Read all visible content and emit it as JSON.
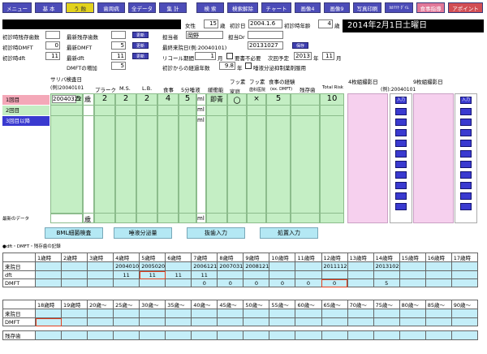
{
  "nav": {
    "menu": "メニュー",
    "basic": "基 本",
    "cavity": "う 蝕",
    "perio": "歯周病",
    "all_data": "全データ",
    "total": "集 計",
    "search": "検 索",
    "search_clear": "検索解除",
    "chart": "チャート",
    "image4": "画像4",
    "image9": "画像9",
    "photo_print": "写真印刷",
    "kakarituke": "ｶｶﾘﾂｹ ﾀﾞｲﾑ",
    "food_guidance": "食事指導",
    "appoint": "アポイント"
  },
  "patient": {
    "name": "",
    "gender": "女性",
    "age": "15",
    "age_unit": "歳",
    "first_visit_label": "初診日",
    "first_visit": "2004.1.6",
    "first_visit_age_label": "初診時年齢",
    "first_visit_age": "4",
    "first_visit_age_unit": "歳"
  },
  "date_banner": "2014年2月1日土曜日",
  "info": {
    "init_remaining_label": "初診時残存歯数",
    "init_remaining": "",
    "latest_remaining_label": "最新残存歯数",
    "latest_remaining": "",
    "update_label": "更新",
    "init_dmft_label": "初診時DMFT",
    "init_dmft": "0",
    "latest_dmft_label": "最新DMFT",
    "latest_dmft": "5",
    "init_dft_label": "初診時dft",
    "init_dft": "11",
    "latest_dft_label": "最新dft",
    "latest_dft": "11",
    "dmft_increase_label": "DMFTの増加",
    "dmft_increase": "5",
    "staff_label": "担当者",
    "staff": "岡野",
    "staff_dr_label": "担当Dr",
    "staff_dr": "",
    "latest_visit_label": "最終来院日(例:20040101)",
    "latest_visit": "20131027",
    "save_label": "保存",
    "recall_label": "リコール期間",
    "recall_value": "1",
    "recall_unit": "月",
    "no_recall_label": "要書不必要",
    "next_label": "次回予定",
    "next_year": "2013",
    "next_year_unit": "年",
    "next_month": "11",
    "next_month_unit": "月",
    "elapsed_label": "初診からの経過年数",
    "elapsed": "9.8",
    "elapsed_unit": "年",
    "fluoride_label": "唾液分泌抑制薬剤服用"
  },
  "grid": {
    "saliva_label": "サリバ検査日",
    "saliva_example": "(例)20040101",
    "plaque_label": "プラーク",
    "ms_label": "M.S.",
    "lb_label": "L.B.",
    "meals_label": "食事",
    "five_min_label": "5分唾液",
    "buffer_label": "緩衝能",
    "fluor_label": "フッ素",
    "fluor_home_label": "家庭",
    "fluor_acc_label": "フッ素",
    "fluor_acc_sub": "歯科医院",
    "exp_label": "食事の経験",
    "exp_sub": "(ex. DMFT)",
    "remaining_label": "残存歯",
    "risk_label": "Total Risk",
    "pic4_label": "4枚組撮影日",
    "pic9_label": "9枚組撮影日",
    "pic_example": "(例):20040101",
    "row1_label": "1回目",
    "row2_label": "2回目",
    "row3_label": "3回目以降",
    "latest_label": "最新のデータ",
    "row1": {
      "date": "20040322",
      "age": "5",
      "age_unit": "歳",
      "plaque": "2",
      "ms": "2",
      "lb": "2",
      "meals": "4",
      "saliva": "5",
      "ml": "ml",
      "buffer": "即青",
      "fluor_home": "〇",
      "fluor_acc": "×",
      "exp": "5",
      "risk": "10"
    },
    "ml_unit": "ml",
    "age_unit": "歳",
    "import_label": "入力"
  },
  "actions": {
    "bml": "BML細菌検査",
    "saliva": "唾液分泌量",
    "extract": "抜歯入力",
    "treatment": "処置入力"
  },
  "records_title": "dft・DMFT・残存歯の記録",
  "records": {
    "ages_top": [
      "1歳時",
      "2歳時",
      "3歳時",
      "4歳時",
      "5歳時",
      "6歳時",
      "7歳時",
      "8歳時",
      "9歳時",
      "10歳時",
      "11歳時",
      "12歳時",
      "13歳時",
      "14歳時",
      "15歳時",
      "16歳時",
      "17歳時"
    ],
    "visit_label": "来院日",
    "dft_label": "dft",
    "dmft_label": "DMFT",
    "visits_top": [
      "",
      "",
      "",
      "2004010",
      "2005020",
      "",
      "2006121",
      "2007031",
      "2008121",
      "",
      "",
      "2011112",
      "",
      "2013102",
      "",
      "",
      ""
    ],
    "dft_top": [
      "",
      "",
      "",
      "11",
      "11",
      "11",
      "11",
      "",
      "",
      "",
      "",
      "",
      "",
      "",
      "",
      "",
      ""
    ],
    "dmft_top": [
      "",
      "",
      "",
      "",
      "",
      "",
      "0",
      "0",
      "0",
      "0",
      "0",
      "0",
      "",
      "5",
      "",
      "",
      ""
    ],
    "ages_bottom": [
      "18歳時",
      "19歳時",
      "20歳～",
      "25歳～",
      "30歳～",
      "35歳～",
      "40歳～",
      "45歳～",
      "50歳～",
      "55歳～",
      "60歳～",
      "65歳～",
      "70歳～",
      "75歳～",
      "80歳～",
      "85歳～",
      "90歳～"
    ],
    "remaining_label": "残存歯"
  }
}
